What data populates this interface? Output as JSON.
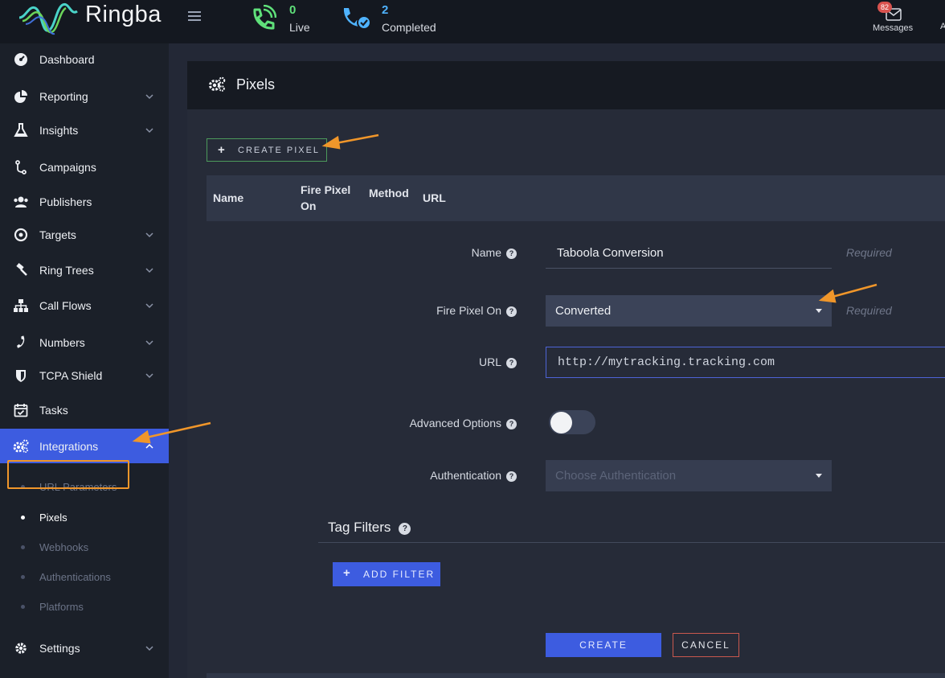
{
  "brand": {
    "name": "Ringba"
  },
  "topbar": {
    "live": {
      "count": "0",
      "label": "Live"
    },
    "completed": {
      "count": "2",
      "label": "Completed"
    },
    "messages": {
      "badge": "82",
      "label": "Messages"
    },
    "edge_char": "A"
  },
  "sidebar": {
    "items": [
      {
        "label": "Dashboard",
        "icon": "dashboard-icon"
      },
      {
        "label": "Reporting",
        "icon": "pie-chart-icon"
      },
      {
        "label": "Insights",
        "icon": "flask-icon"
      },
      {
        "label": "Campaigns",
        "icon": "branch-icon"
      },
      {
        "label": "Publishers",
        "icon": "users-icon"
      },
      {
        "label": "Targets",
        "icon": "target-icon"
      },
      {
        "label": "Ring Trees",
        "icon": "gavel-icon"
      },
      {
        "label": "Call Flows",
        "icon": "sitemap-icon"
      },
      {
        "label": "Numbers",
        "icon": "phone-icon"
      },
      {
        "label": "TCPA Shield",
        "icon": "shield-icon"
      },
      {
        "label": "Tasks",
        "icon": "calendar-check-icon"
      },
      {
        "label": "Integrations",
        "icon": "cogs-icon"
      },
      {
        "label": "Settings",
        "icon": "gear-icon"
      }
    ],
    "integrations_sub": [
      {
        "label": "URL Parameters"
      },
      {
        "label": "Pixels"
      },
      {
        "label": "Webhooks"
      },
      {
        "label": "Authentications"
      },
      {
        "label": "Platforms"
      }
    ]
  },
  "page": {
    "title": "Pixels",
    "create_pixel_label": "CREATE PIXEL",
    "table_headers": {
      "name": "Name",
      "fire_line1": "Fire Pixel",
      "fire_line2": "On",
      "method": "Method",
      "url": "URL"
    }
  },
  "form": {
    "name": {
      "label": "Name",
      "value": "Taboola Conversion",
      "required": "Required"
    },
    "fire_pixel_on": {
      "label": "Fire Pixel On",
      "value": "Converted",
      "required": "Required"
    },
    "url": {
      "label": "URL",
      "value": "http://mytracking.tracking.com"
    },
    "advanced_options": {
      "label": "Advanced Options"
    },
    "authentication": {
      "label": "Authentication",
      "placeholder": "Choose Authentication"
    },
    "tag_filters": {
      "title": "Tag Filters",
      "add_filter_label": "ADD FILTER"
    },
    "create_label": "CREATE",
    "cancel_label": "CANCEL",
    "help_glyph": "?"
  },
  "colors": {
    "accent": "#3d5ce0",
    "annotation": "#f0962a",
    "live": "#5fe07a",
    "completed": "#4fb3ff"
  }
}
